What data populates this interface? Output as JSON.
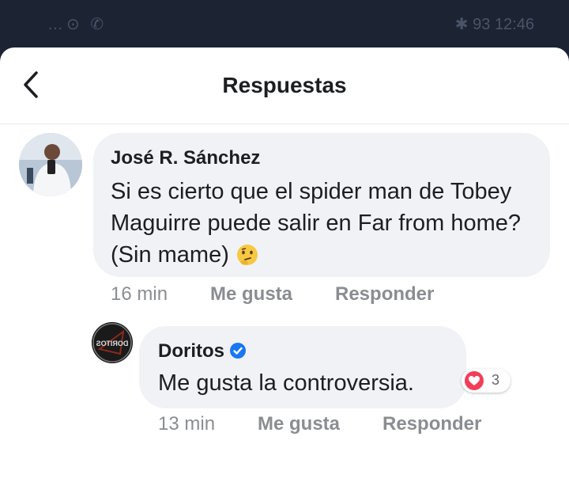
{
  "status_bar": {
    "left_icons": "…⊙ ✆",
    "battery": "93",
    "time": "12:46"
  },
  "header": {
    "title": "Respuestas",
    "back_icon": "chevron-left-icon"
  },
  "comments": [
    {
      "author": "José R. Sánchez",
      "text": "Si es cierto que el spider man de Tobey Maguirre puede salir en Far from home? (Sin mame)",
      "emoji": "thinking-face-icon",
      "time": "16 min",
      "like_label": "Me gusta",
      "reply_label": "Responder"
    },
    {
      "author": "Doritos",
      "verified": true,
      "text": "Me gusta la controversia.",
      "time": "13 min",
      "like_label": "Me gusta",
      "reply_label": "Responder",
      "reaction": {
        "icon": "love-reaction-icon",
        "count": "3"
      }
    }
  ],
  "colors": {
    "accent": "#1877f2",
    "love": "#f33e58",
    "bubble": "#f0f2f5"
  }
}
